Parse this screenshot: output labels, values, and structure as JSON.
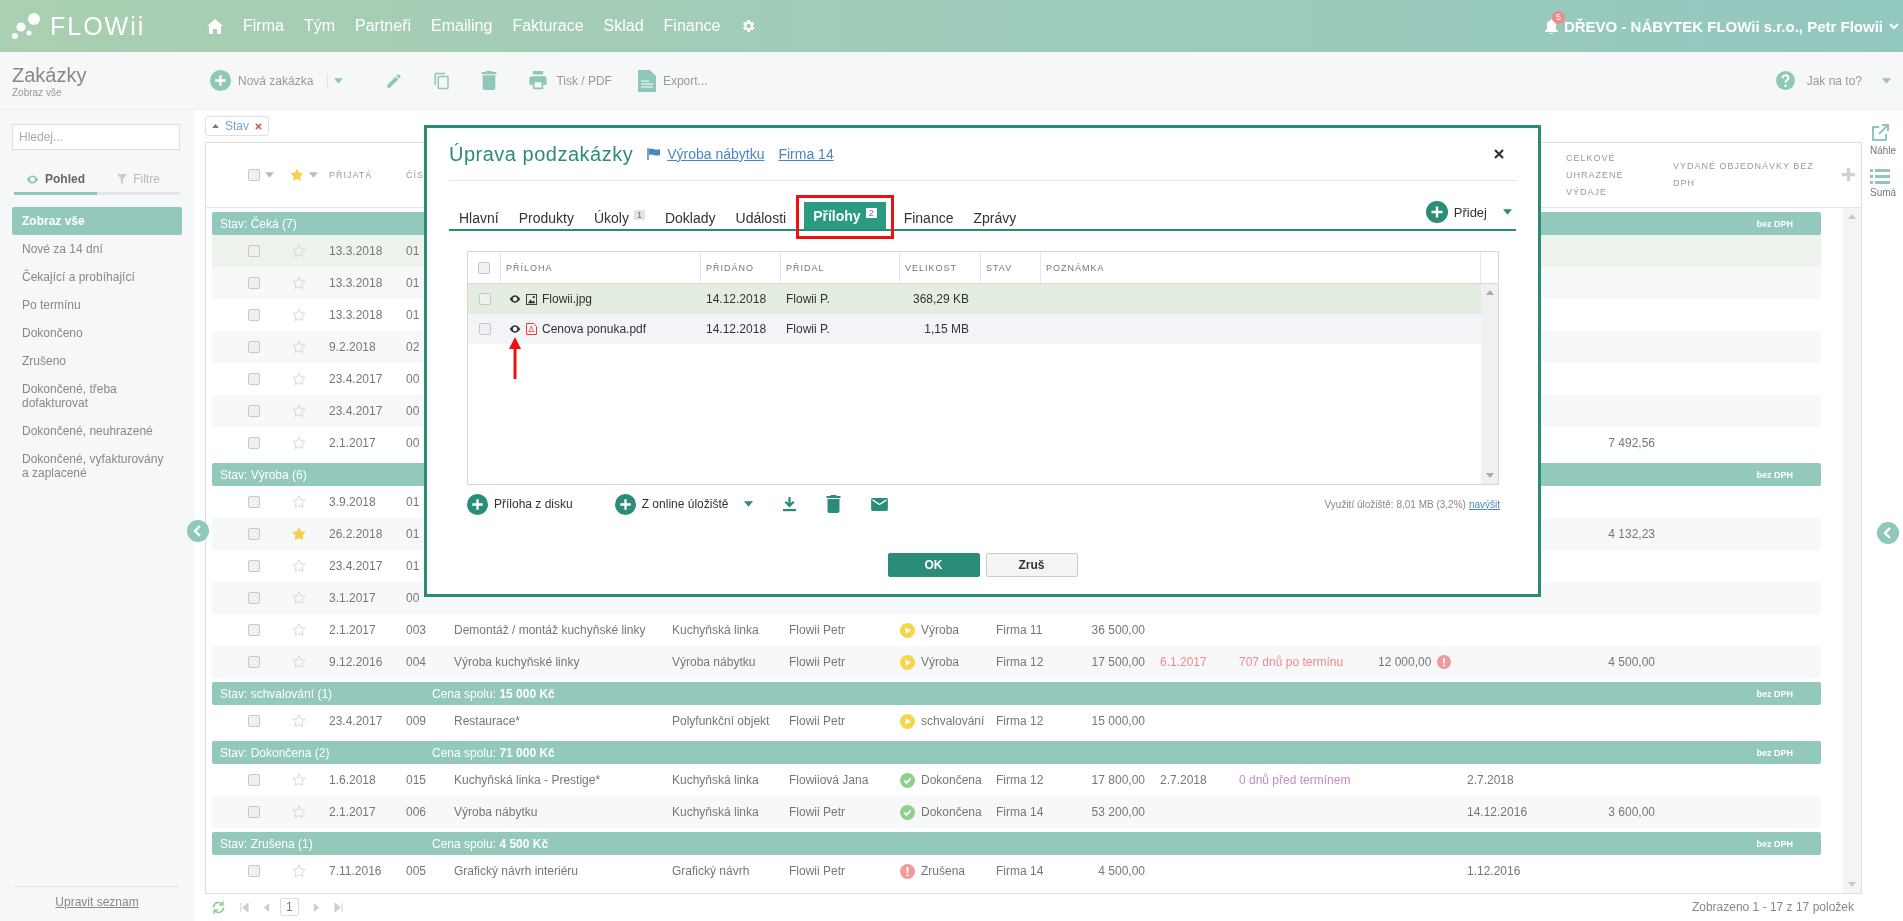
{
  "header": {
    "logo": "FLOWii",
    "nav": [
      {
        "label": "Firma"
      },
      {
        "label": "Tým"
      },
      {
        "label": "Partneři"
      },
      {
        "label": "Emailing"
      },
      {
        "label": "Fakturace"
      },
      {
        "label": "Sklad"
      },
      {
        "label": "Finance"
      }
    ],
    "notifications": "5",
    "account": "DŘEVO - NÁBYTEK FLOWii s.r.o., Petr Flowii"
  },
  "page": {
    "title": "Zakázky",
    "subtitle": "Zobraz vše"
  },
  "toolbar": {
    "buttons": [
      {
        "kind": "add",
        "label": "Nová zakázka"
      },
      {
        "kind": "menu"
      },
      {
        "kind": "edit"
      },
      {
        "kind": "copy"
      },
      {
        "kind": "delete"
      },
      {
        "kind": "print",
        "label": "Tisk / PDF"
      },
      {
        "kind": "export",
        "label": "Export..."
      }
    ],
    "help": "Jak na to?"
  },
  "sidebar": {
    "search": {
      "placeholder": "Hledej..."
    },
    "tabs": [
      {
        "label": "Pohled",
        "selected": true
      },
      {
        "label": "Filtre",
        "selected": false
      }
    ],
    "items": [
      {
        "label": "Zobraz vše",
        "selected": true
      },
      {
        "label": "Nové za 14 dní",
        "selected": false
      },
      {
        "label": "Čekající a probíhající",
        "selected": false
      },
      {
        "label": "Po termínu",
        "selected": false
      },
      {
        "label": "Dokončeno",
        "selected": false
      },
      {
        "label": "Zrušeno",
        "selected": false
      },
      {
        "label": "Dokončené, třeba dofakturovat",
        "selected": false
      },
      {
        "label": "Dokončené, neuhrazené",
        "selected": false
      },
      {
        "label": "Dokončené, vyfakturovány a zaplacené",
        "selected": false
      }
    ],
    "footer_link": "Upravit seznam"
  },
  "filter_chips": [
    {
      "label": "Stav"
    }
  ],
  "table": {
    "all_checked": false,
    "columns": {
      "date": "PŘIJATÁ",
      "number": "ČÍS",
      "paid_total": "CELKOVÉ UHRAZENÉ VÝDAJE",
      "orders": "VYDANÉ OBJEDNÁVKY BEZ DPH"
    },
    "groups": [
      {
        "title": "Stav: Čeká (7)",
        "note": "bez DPH",
        "rows": [
          {
            "date": "13.3.2018",
            "number": "01",
            "starred": false,
            "selected": true
          },
          {
            "date": "13.3.2018",
            "number": "01",
            "starred": false,
            "selected": false
          },
          {
            "date": "13.3.2018",
            "number": "01",
            "starred": false,
            "selected": false
          },
          {
            "date": "9.2.2018",
            "number": "02",
            "starred": false,
            "selected": false
          },
          {
            "date": "23.4.2017",
            "number": "00",
            "starred": false,
            "selected": false
          },
          {
            "date": "23.4.2017",
            "number": "00",
            "starred": false,
            "selected": false
          },
          {
            "date": "2.1.2017",
            "number": "00",
            "ordered": "7 492,56",
            "starred": false,
            "selected": false
          }
        ]
      },
      {
        "title": "Stav: Výroba (6)",
        "note": "bez DPH",
        "rows": [
          {
            "date": "3.9.2018",
            "number": "01",
            "starred": false,
            "selected": false
          },
          {
            "date": "26.2.2018",
            "number": "01",
            "ordered": "4 132,23",
            "starred": true,
            "selected": false
          },
          {
            "date": "23.4.2017",
            "number": "01",
            "starred": false,
            "selected": false
          },
          {
            "date": "3.1.2017",
            "number": "00",
            "starred": false,
            "selected": false
          },
          {
            "date": "2.1.2017",
            "number": "003",
            "name": "Demontáž / montáž kuchyňské linky",
            "type": "Kuchyňská linka",
            "person": "Flowii Petr",
            "status": {
              "kind": "in_progress",
              "label": "Výroba"
            },
            "firm": "Firma 11",
            "amount": "36 500,00",
            "starred": false,
            "selected": false
          },
          {
            "date": "9.12.2016",
            "number": "004",
            "name": "Výroba kuchyňské linky",
            "type": "Výroba nábytku",
            "person": "Flowii Petr",
            "status": {
              "kind": "in_progress",
              "label": "Výroba"
            },
            "firm": "Firma 12",
            "amount": "17 500,00",
            "due": "6.1.2017",
            "term": "707 dnů po termínu",
            "overdue": true,
            "paid": "12 000,00",
            "paid_alert": true,
            "ordered": "4 500,00",
            "starred": false,
            "selected": false
          }
        ]
      },
      {
        "title": "Stav: schvalování (1)",
        "total": "Cena spolu: **15 000 Kč**",
        "note": "bez DPH",
        "rows": [
          {
            "date": "23.4.2017",
            "number": "009",
            "name": "Restaurace*",
            "type": "Polyfunkční objekt",
            "person": "Flowii Petr",
            "status": {
              "kind": "in_progress",
              "label": "schvalování"
            },
            "firm": "Firma 12",
            "amount": "15 000,00",
            "starred": false,
            "selected": false
          }
        ]
      },
      {
        "title": "Stav: Dokončena (2)",
        "total": "Cena spolu: **71 000 Kč**",
        "note": "bez DPH",
        "rows": [
          {
            "date": "1.6.2018",
            "number": "015",
            "name": "Kuchyňská linka - Prestige*",
            "type": "Kuchyňská linka",
            "person": "Flowiiová Jana",
            "status": {
              "kind": "done",
              "label": "Dokončena"
            },
            "firm": "Firma 12",
            "amount": "17 800,00",
            "due": "2.7.2018",
            "term": "0 dnů před termínem",
            "overdue": false,
            "finished": "2.7.2018",
            "starred": false,
            "selected": false
          },
          {
            "date": "2.1.2017",
            "number": "006",
            "name": "Výroba nábytku",
            "type": "Kuchyňská linka",
            "person": "Flowii Petr",
            "status": {
              "kind": "done",
              "label": "Dokončena"
            },
            "firm": "Firma 14",
            "amount": "53 200,00",
            "finished": "14.12.2016",
            "ordered": "3 600,00",
            "starred": false,
            "selected": false
          }
        ]
      },
      {
        "title": "Stav: Zrušena (1)",
        "total": "Cena spolu: **4 500 Kč**",
        "note": "bez DPH",
        "rows": [
          {
            "date": "7.11.2016",
            "number": "005",
            "name": "Grafický návrh interiéru",
            "type": "Grafický návrh",
            "person": "Flowii Petr",
            "status": {
              "kind": "cancelled",
              "label": "Zrušena"
            },
            "firm": "Firma 14",
            "amount": "4 500,00",
            "finished": "1.12.2016",
            "starred": false,
            "selected": false
          }
        ]
      }
    ]
  },
  "pager": {
    "page": "1",
    "summary": "Zobrazeno 1 - 17 z 17 položek"
  },
  "right_panel": [
    {
      "kind": "preview",
      "label": "Náhle"
    },
    {
      "kind": "summary",
      "label": "Sumá"
    }
  ],
  "modal": {
    "title": "Úprava podzakázky",
    "links": [
      {
        "kind": "flag",
        "label": "Výroba nábytku"
      },
      {
        "kind": "plain",
        "label": "Firma 14"
      }
    ],
    "tabs": [
      {
        "label": "Hlavní",
        "selected": false,
        "framed": false
      },
      {
        "label": "Produkty",
        "selected": false,
        "framed": false
      },
      {
        "label": "Úkoly",
        "badge": "1",
        "selected": false,
        "framed": false
      },
      {
        "label": "Doklady",
        "selected": false,
        "framed": false
      },
      {
        "label": "Události",
        "selected": false,
        "framed": false
      },
      {
        "label": "Přílohy",
        "badge": "2",
        "selected": true,
        "framed": true
      },
      {
        "label": "Finance",
        "selected": false,
        "framed": false
      },
      {
        "label": "Zprávy",
        "selected": false,
        "framed": false
      }
    ],
    "add_button": "Přidej",
    "attachments": {
      "all_checked": false,
      "columns": [
        "PŘÍLOHA",
        "PŘIDÁNO",
        "PŘIDAL",
        "VELIKOST",
        "STAV",
        "POZNÁMKA"
      ],
      "rows": [
        {
          "kind": "image",
          "name": "Flowii.jpg",
          "added": "14.12.2018",
          "by": "Flowii P.",
          "size": "368,29 KB",
          "selected": true,
          "pointer": false
        },
        {
          "kind": "pdf",
          "name": "Cenova ponuka.pdf",
          "added": "14.12.2018",
          "by": "Flowii P.",
          "size": "1,15 MB",
          "selected": false,
          "pointer": true
        }
      ]
    },
    "actions": [
      {
        "kind": "add",
        "label": "Příloha z disku"
      },
      {
        "kind": "add_menu",
        "label": "Z online úložiště"
      },
      {
        "kind": "download"
      },
      {
        "kind": "delete"
      },
      {
        "kind": "mail"
      }
    ],
    "storage": "Využití úložiště: 8,01 MB (3,2%)",
    "storage_link": "navýšit",
    "buttons": [
      {
        "kind": "primary",
        "label": "OK"
      },
      {
        "kind": "secondary",
        "label": "Zruš"
      }
    ]
  }
}
